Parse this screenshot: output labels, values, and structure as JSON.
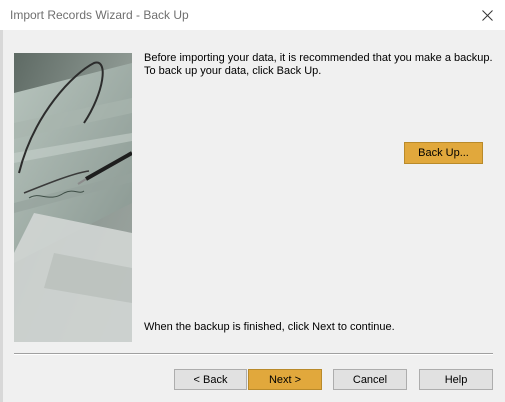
{
  "window": {
    "title": "Import Records Wizard - Back Up"
  },
  "body": {
    "intro_line1": "Before importing your data, it is recommended that you make a backup.",
    "intro_line2": "To back up your data, click Back Up.",
    "finish_note": "When the backup is finished, click Next to continue."
  },
  "buttons": {
    "backup": "Back Up...",
    "back": "< Back",
    "next": "Next >",
    "cancel": "Cancel",
    "help": "Help"
  },
  "colors": {
    "accent_button": "#e1a83c",
    "background": "#f0f0f0"
  },
  "icons": {
    "close": "close-icon"
  }
}
